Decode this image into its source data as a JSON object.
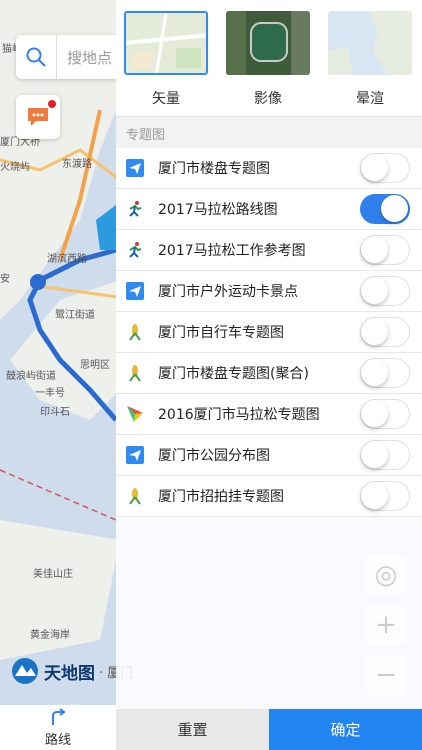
{
  "search": {
    "placeholder": "搜地点"
  },
  "map": {
    "labels": [
      "猫屿",
      "鼓浪屿街道",
      "印斗石",
      "一丰号",
      "鹭江街道",
      "思明区",
      "美佳山庄",
      "黄金海岸",
      "厦门大桥",
      "火烧屿",
      "东渡路",
      "湖滨西路",
      "安"
    ],
    "logo_text": "天地图",
    "logo_sub": "· 厦门"
  },
  "base_layers": [
    {
      "label": "矢量",
      "selected": true
    },
    {
      "label": "影像",
      "selected": false
    },
    {
      "label": "晕渲",
      "selected": false
    }
  ],
  "section_title": "专题图",
  "layers": [
    {
      "label": "厦门市楼盘专题图",
      "icon": "paper-plane-icon",
      "on": false
    },
    {
      "label": "2017马拉松路线图",
      "icon": "runner-icon",
      "on": true
    },
    {
      "label": "2017马拉松工作参考图",
      "icon": "runner-icon",
      "on": false
    },
    {
      "label": "厦门市户外运动卡景点",
      "icon": "paper-plane-icon",
      "on": false
    },
    {
      "label": "厦门市自行车专题图",
      "icon": "corn-icon",
      "on": false
    },
    {
      "label": "厦门市楼盘专题图(聚合)",
      "icon": "corn-icon",
      "on": false
    },
    {
      "label": "2016厦门市马拉松专题图",
      "icon": "kite-icon",
      "on": false
    },
    {
      "label": "厦门市公园分布图",
      "icon": "paper-plane-icon",
      "on": false
    },
    {
      "label": "厦门市招拍挂专题图",
      "icon": "corn-icon",
      "on": false
    }
  ],
  "footer": {
    "reset": "重置",
    "confirm": "确定"
  },
  "nav": {
    "route_label": "路线"
  },
  "colors": {
    "accent": "#2184f1",
    "route": "#2b6ad0"
  }
}
